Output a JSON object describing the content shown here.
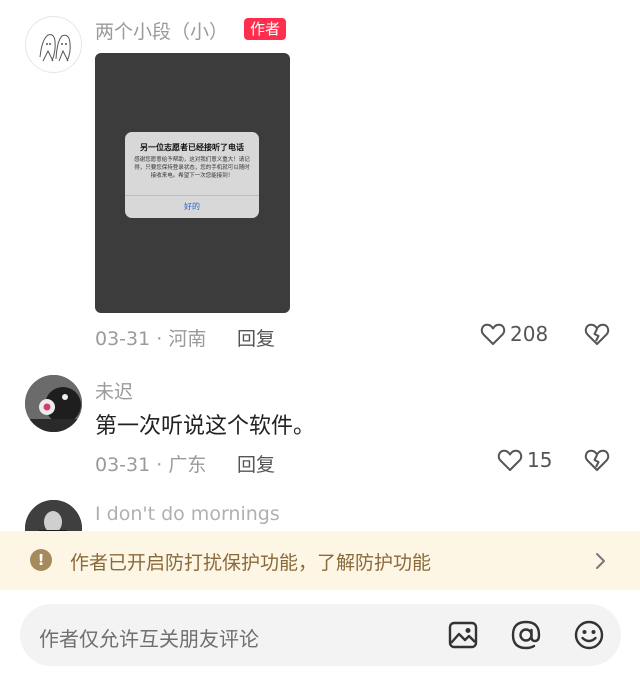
{
  "comments": [
    {
      "username": "两个小段（小）",
      "badge": "作者",
      "image": {
        "dialog_title": "另一位志愿者已经接听了电话",
        "dialog_body": "感谢您愿意给予帮助，这对我们意义重大！请记得，只要您保持登录状态，您的手机就可以随时接收来电。希望下一次您能接到！",
        "dialog_button": "好的"
      },
      "date": "03-31",
      "separator": "·",
      "location": "河南",
      "reply_label": "回复",
      "likes": "208"
    },
    {
      "username": "未迟",
      "text": "第一次听说这个软件。",
      "date": "03-31",
      "separator": "·",
      "location": "广东",
      "reply_label": "回复",
      "likes": "15"
    },
    {
      "username": "I don't do mornings"
    }
  ],
  "banner": {
    "icon": "!",
    "text": "作者已开启防打扰保护功能，了解防护功能"
  },
  "input": {
    "placeholder": "作者仅允许互关朋友评论",
    "icons": [
      "image-icon",
      "at-icon",
      "emoji-icon"
    ]
  },
  "colors": {
    "badge": "#ff2e4d",
    "banner_bg": "#fdf6e5",
    "banner_text": "#8a6a3b"
  }
}
